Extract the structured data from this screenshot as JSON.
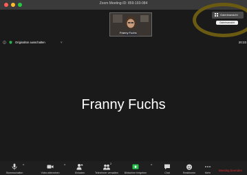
{
  "window": {
    "title": "Zoom Meeting-ID: 859-193-084"
  },
  "self_view": {
    "name": "Franny Fuchs"
  },
  "top_right": {
    "gallery_view_label": "Galerieansicht",
    "gallery_view_tooltip": "Galerieansicht"
  },
  "info_bar": {
    "original_sound_label": "Originalton ausschalten",
    "caret": "˅",
    "time": "20:23"
  },
  "main": {
    "speaker_name": "Franny Fuchs"
  },
  "toolbar": {
    "items": [
      {
        "label": "Stummschalten",
        "icon": "microphone-icon"
      },
      {
        "label": "Video abbrechen",
        "icon": "video-camera-icon"
      },
      {
        "label": "Einladen",
        "icon": "add-person-icon"
      },
      {
        "label": "Teilnehmer verwalten",
        "icon": "participants-icon",
        "count": "2"
      },
      {
        "label": "Bildschirm freigeben",
        "icon": "share-screen-icon"
      },
      {
        "label": "Chat",
        "icon": "chat-icon"
      },
      {
        "label": "Reaktionen",
        "icon": "reactions-icon"
      },
      {
        "label": "Mehr",
        "icon": "more-icon"
      }
    ],
    "caret": "^",
    "end_label": "Meeting beenden",
    "share_color": "#27c24c",
    "end_color": "#e02828"
  },
  "annotation": {
    "ring_color": "#6b5a12"
  }
}
